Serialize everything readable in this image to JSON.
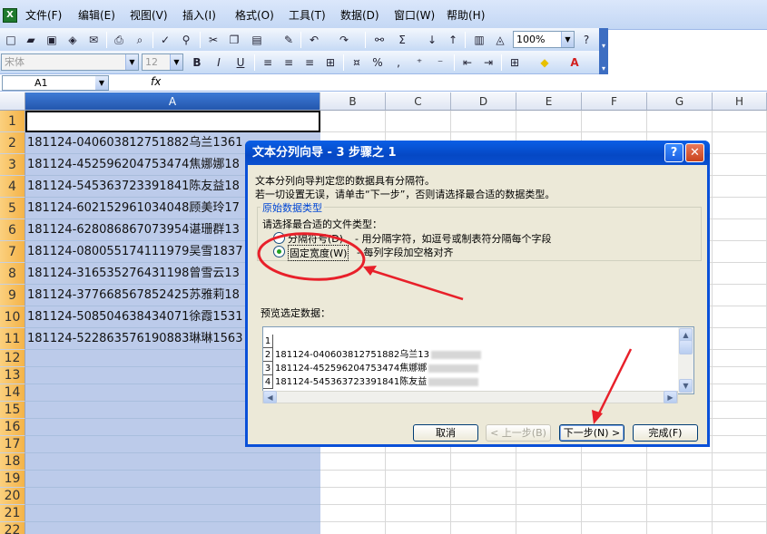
{
  "app": {
    "icon_label": "X"
  },
  "menu": [
    "文件(F)",
    "编辑(E)",
    "视图(V)",
    "插入(I)",
    "格式(O)",
    "工具(T)",
    "数据(D)",
    "窗口(W)",
    "帮助(H)"
  ],
  "toolbar": {
    "zoom": "100%"
  },
  "format_toolbar": {
    "font": "宋体",
    "size": "12"
  },
  "name_box": "A1",
  "fx_label": "fx",
  "columns": [
    "A",
    "B",
    "C",
    "D",
    "E",
    "F",
    "G",
    "H"
  ],
  "rows": [
    "1",
    "2",
    "3",
    "4",
    "5",
    "6",
    "7",
    "8",
    "9",
    "10",
    "11",
    "12",
    "13",
    "14",
    "15",
    "16",
    "17",
    "18",
    "19",
    "20",
    "21",
    "22"
  ],
  "cells_a": [
    "",
    "181124-040603812751882乌兰1361",
    "181124-452596204753474焦娜娜18",
    "181124-545363723391841陈友益18",
    "181124-602152961034048顾美玲17",
    "181124-628086867073954谌珊群13",
    "181124-080055174111979吴雪1837",
    "181124-316535276431198曾雪云13",
    "181124-377668567852425苏雅莉18",
    "181124-508504638434071徐霞1531",
    "181124-522863576190883琳琳1563"
  ],
  "dialog": {
    "title": "文本分列向导 - 3 步骤之 1",
    "intro1": "文本分列向导判定您的数据具有分隔符。",
    "intro2": "若一切设置无误，请单击“下一步”，否则请选择最合适的数据类型。",
    "group_title": "原始数据类型",
    "group_prompt": "请选择最合适的文件类型：",
    "opt_delimited": "分隔符号(D)",
    "opt_delimited_desc": "- 用分隔字符，如逗号或制表符分隔每个字段",
    "opt_fixed": "固定宽度(W)",
    "opt_fixed_desc": "- 每列字段加空格对齐",
    "preview_label": "预览选定数据：",
    "preview_rows": [
      {
        "n": "1",
        "text": ""
      },
      {
        "n": "2",
        "text": "181124-040603812751882乌兰13"
      },
      {
        "n": "3",
        "text": "181124-452596204753474焦娜娜"
      },
      {
        "n": "4",
        "text": "181124-545363723391841陈友益"
      }
    ],
    "btn_cancel": "取消",
    "btn_back": "< 上一步(B)",
    "btn_next": "下一步(N) >",
    "btn_finish": "完成(F)",
    "help": "?",
    "close": "✕"
  },
  "colors": {
    "annotation": "#e8202a",
    "selection": "#bccbea",
    "title_bar": "#0a50d8"
  }
}
